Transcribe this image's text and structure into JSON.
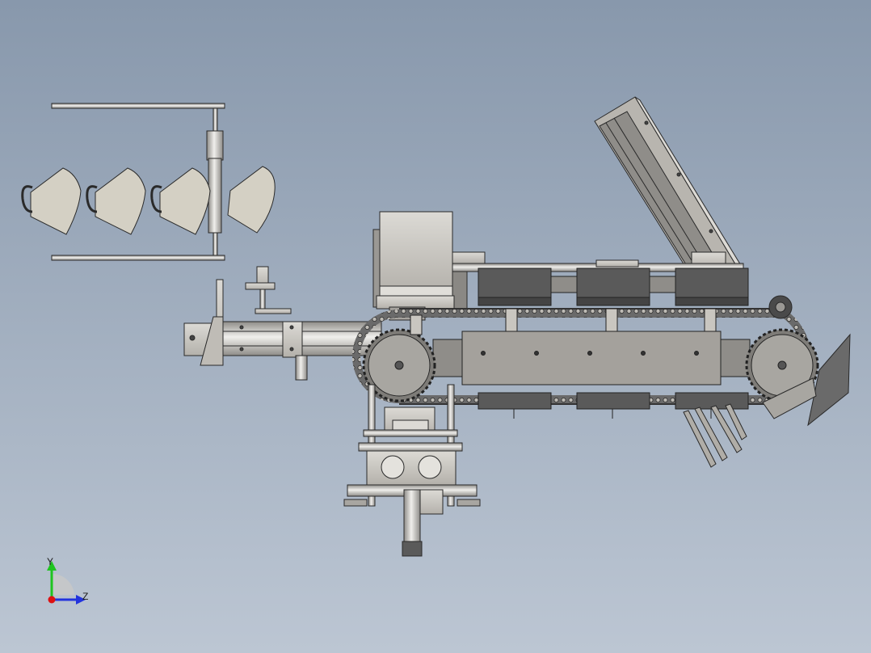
{
  "view": {
    "background_top": "#8898ac",
    "background_bottom": "#bcc6d3"
  },
  "triad": {
    "y_label": "Y",
    "z_label": "Z",
    "y_color": "#1fc41f",
    "z_color": "#2233dd",
    "x_color": "#dd1111"
  },
  "parts": {
    "metal_color": "#c9c6c0",
    "dark_part_color": "#5a5a5a",
    "mask_color": "#d4d0c4",
    "outline_color": "#2a2a2a"
  }
}
